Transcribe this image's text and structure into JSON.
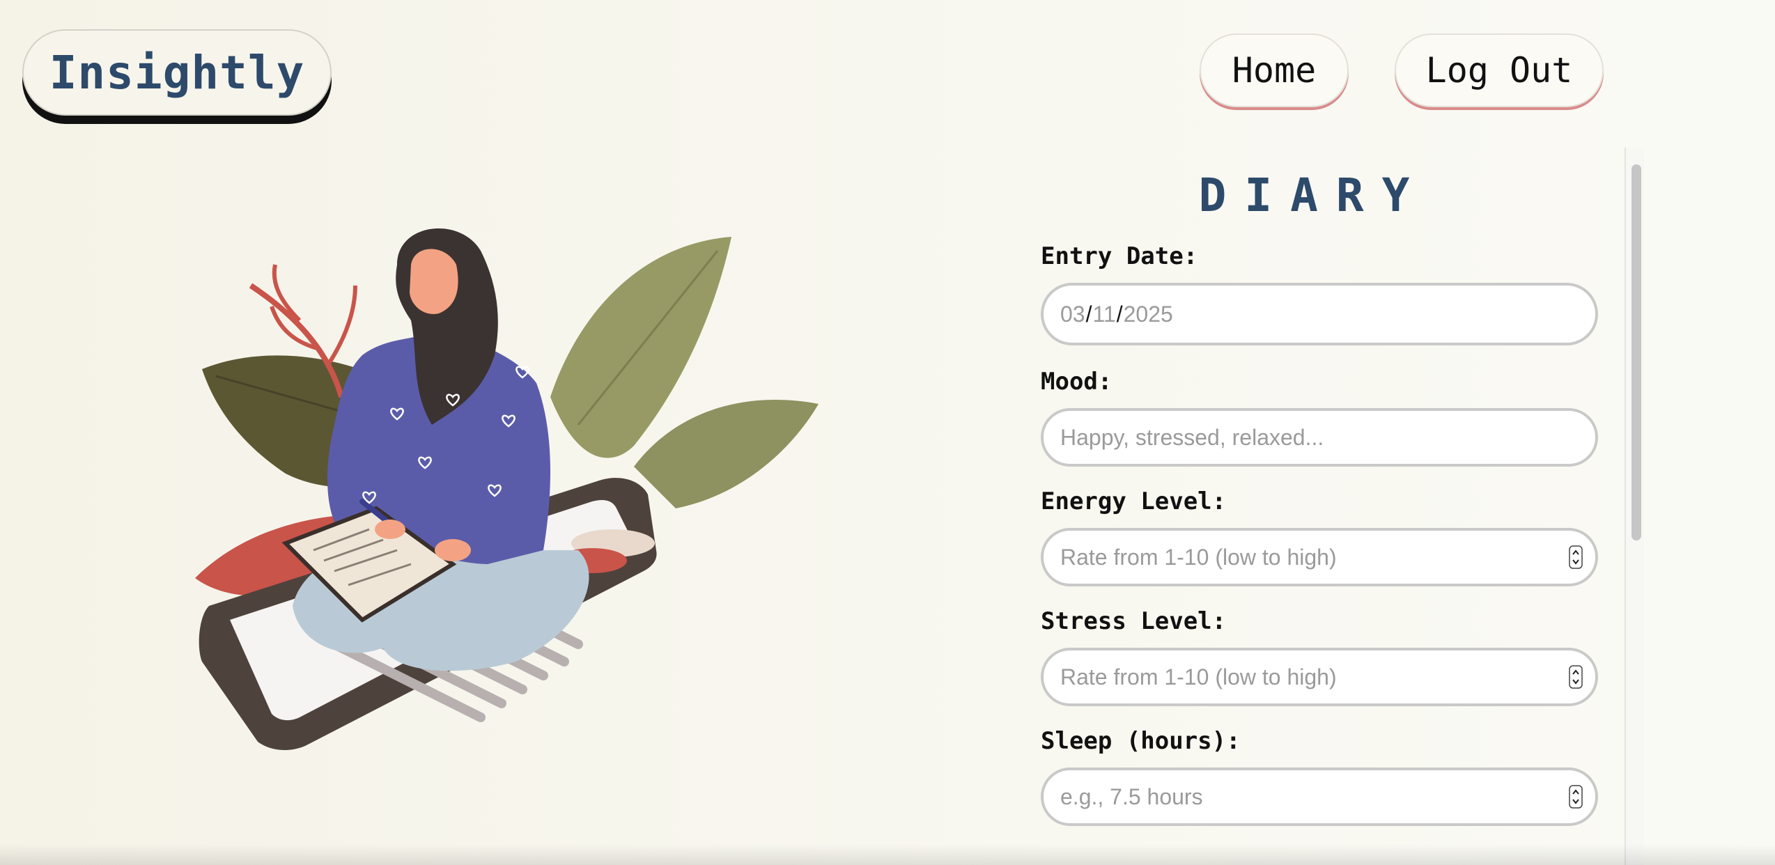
{
  "header": {
    "logo": "Insightly",
    "nav": {
      "home": "Home",
      "logout": "Log Out"
    }
  },
  "illustration": {
    "description_icon": "woman-writing-diary-illustration"
  },
  "diary": {
    "title": "DIARY",
    "entry_date": {
      "label": "Entry Date:",
      "month": "03",
      "day": "11",
      "year": "2025"
    },
    "mood": {
      "label": "Mood:",
      "placeholder": "Happy, stressed, relaxed..."
    },
    "energy": {
      "label": "Energy Level:",
      "placeholder": "Rate from 1-10 (low to high)"
    },
    "stress": {
      "label": "Stress Level:",
      "placeholder": "Rate from 1-10 (low to high)"
    },
    "sleep": {
      "label": "Sleep (hours):",
      "placeholder": "e.g., 7.5 hours"
    }
  },
  "colors": {
    "brand": "#2d4a6b",
    "nav_accent": "#d98b8b",
    "background": "#f5f3e8"
  }
}
